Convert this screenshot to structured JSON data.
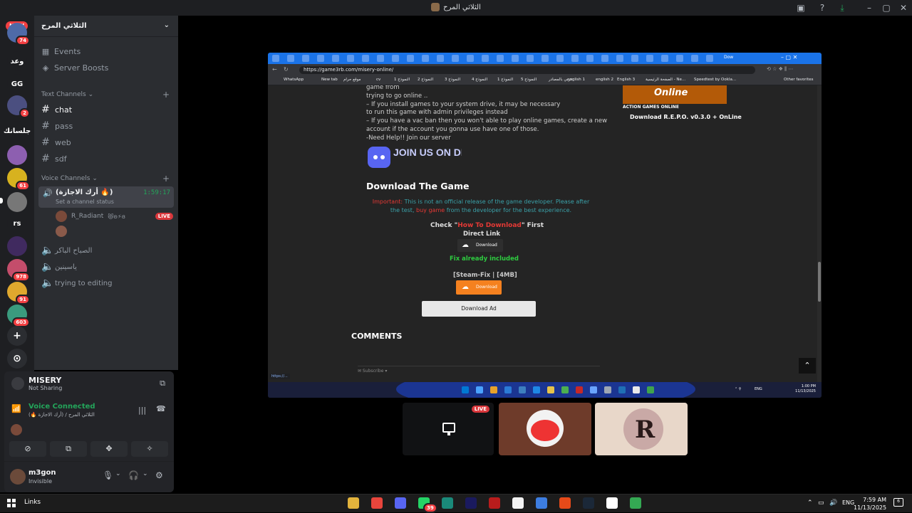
{
  "window": {
    "title": "الثلاثي المرح"
  },
  "guilds": {
    "new_badge": "NEW",
    "items": [
      {
        "label": "",
        "badge": "74",
        "color": "#4e6aa8"
      },
      {
        "label": "وعد",
        "badge": "",
        "color": "#1e1f22"
      },
      {
        "label": "GG",
        "badge": "",
        "color": "#1e1f22"
      },
      {
        "label": "",
        "badge": "2",
        "color": "#4b4f80"
      },
      {
        "label": "جلسانك",
        "badge": "",
        "color": "#1e1f22"
      },
      {
        "label": "",
        "badge": "",
        "color": "#8d5fb0"
      },
      {
        "label": "",
        "badge": "61",
        "color": "#d7b21f"
      },
      {
        "label": "",
        "badge": "",
        "color": "#777777"
      },
      {
        "label": "rs",
        "badge": "",
        "color": "#1e1f22"
      },
      {
        "label": "",
        "badge": "",
        "color": "#402a5f"
      },
      {
        "label": "",
        "badge": "978",
        "color": "#c44d6b"
      },
      {
        "label": "",
        "badge": "91",
        "color": "#e0a82e"
      },
      {
        "label": "",
        "badge": "603",
        "color": "#3a9b7e"
      }
    ],
    "add_icon": "+",
    "discover_icon": "⊙"
  },
  "sidebar": {
    "server_name": "الثلاثي المرح",
    "events": "Events",
    "boosts": "Server Boosts",
    "text_category": "Text Channels",
    "text_channels": [
      "chat",
      "pass",
      "web",
      "sdf"
    ],
    "voice_category": "Voice Channels",
    "active_voice": {
      "name": "(أرك الاجازة 🔥)",
      "time": "1:59:17",
      "status": "Set a channel status"
    },
    "voice_user": "R_Radiant",
    "voice_user_extra": "😻ʚ⚡ɞ",
    "live_label": "LIVE",
    "voice_channels": [
      "الصباح الباكر",
      "ياسينين",
      "trying to editing"
    ]
  },
  "panel": {
    "share_name": "MISERY",
    "share_status": "Not Sharing",
    "voice_connected": "Voice Connected",
    "voice_channel": "الثلاثي المرح / (أرك الاجازة 🔥)",
    "user_name": "m3gon",
    "user_status": "Invisible"
  },
  "browser": {
    "url": "https://game3rb.com/misery-online/",
    "tab_title": "Dow",
    "bookmarks": [
      "WhatsApp",
      "New tab",
      "موقع حرام",
      "cv",
      "النموذج 1",
      "النموذج 2",
      "النموذج 3",
      "النموذج 4",
      "النموذج 1",
      "النموذج 5",
      "عربي بالمصادر",
      "english 1",
      "english 2",
      "English 3",
      "الصفحة الرئيسية - Ne...",
      "Speedtest by Ookla...",
      "Other favorites"
    ],
    "page": {
      "lines": [
        "game from",
        "trying to go online ..",
        "– If you install games to your system drive, it may be necessary",
        "to run this game with admin privileges instead",
        "– If you have a vac ban then you won't able to play online games, create a new",
        "account if the account you gonna use have one of those.",
        "-Need Help!! Join our server"
      ],
      "join_discord": "JOIN US ON DISCORD",
      "download_title": "Download The Game",
      "important_label": "Important:",
      "important_text": "This is not an official release of the game developer. Please after the test,",
      "buy_game": "buy game",
      "important_tail": "from the developer for the best experience.",
      "check_prefix": "Check \"",
      "how_to": "How To Download",
      "check_suffix": "\" First",
      "direct_link": "Direct Link",
      "download_btn": "Download",
      "fix_text": "Fix already included",
      "steamfix": "[Steam-Fix | [4MB]",
      "download_btn2": "Download",
      "download_ad": "Download Ad",
      "comments": "COMMENTS",
      "subscribe": "✉ Subscribe ▾",
      "online_label": "Online",
      "tags": "ACTION    GAMES ONLINE",
      "repo": "Download R.E.P.O. v0.3.0 + OnLine"
    },
    "inner_clock": {
      "time": "1:00 PM",
      "date": "11/13/2025"
    },
    "inner_lang": "ENG"
  },
  "tiles": {
    "live_label": "LIVE"
  },
  "taskbar": {
    "links": "Links",
    "tray_lang": "ENG",
    "time": "7:59 AM",
    "date": "11/13/2025",
    "notif_count": "6",
    "discord_badge": "39"
  }
}
